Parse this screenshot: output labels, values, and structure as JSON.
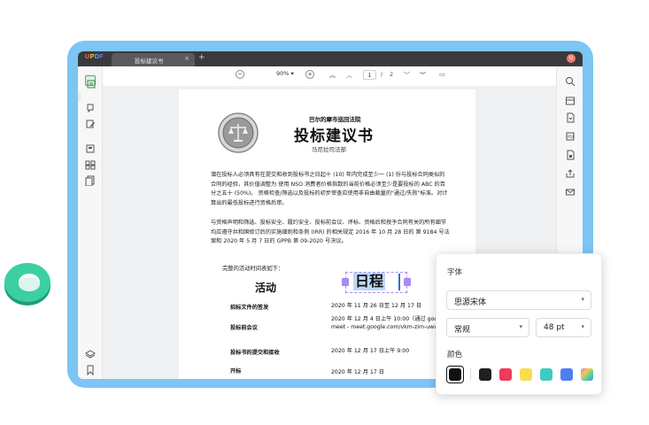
{
  "app": {
    "logo": {
      "u": "U",
      "p": "P",
      "d": "D",
      "f": "F"
    },
    "tab_title": "投标建议书",
    "tab_close": "×",
    "tab_add": "+",
    "user_initial": "U"
  },
  "topnav": {
    "zoom_out": "−",
    "zoom_value": "90%",
    "zoom_caret": "▾",
    "zoom_in": "+",
    "first_page": "︽",
    "prev_page": "︿",
    "current_page": "1",
    "page_separator": "/",
    "total_pages": "2",
    "next_page": "﹀",
    "last_page": "︾",
    "comment": "▭"
  },
  "document": {
    "court_name": "巴尔的摩市巡回法院",
    "title": "投标建议书",
    "department": "马尼拉司法部",
    "paragraph1": "潜在投标人必须具有在提交和收到投标书之日起十 (10) 年内完成至少一 (1) 份与投标合同类似的合同的经验，其价值调整为 使用 NSO 消费者价格指数的当前价格必须至少是要投标的 ABC 的百分之五十 (50%)。 资格检查/筛选以及投标的初步审查应使用非自由裁量的\"通过/失败\"标准。对计算出的最低投标进行资格后审。",
    "paragraph2": "与资格声明和筛选、投标安全、履约安全、投标前会议、评标、资格后和授予合同有关的所有细节均应遵守共和国修订后的实施细则和条例 (IRR) 的相关规定 2016 年 10 月 28 日的 第 9184 号法案和 2020 年 5 月 7 日的 GPPB 第 09-2020 号决议。",
    "intro": "完整的活动时间表如下：",
    "col_activity": "活动",
    "col_schedule": "日程",
    "rows": [
      {
        "label": "招标文件的签发",
        "value": "2020 年 11 月 26 日至 12 月 17 日"
      },
      {
        "label": "投标前会议",
        "value": "2020 年 12 月 4 日上午 10:00（通过 google meet - meet.google.com/vkm-zim-uwx）"
      },
      {
        "label": "投标书的提交和接收",
        "value": "2020 年 12 月 17 日上午 9:00"
      },
      {
        "label": "开标",
        "value": "2020 年 12 月 17 日"
      }
    ]
  },
  "panel": {
    "font_label": "字体",
    "font_family": "思源宋体",
    "font_style": "常规",
    "font_size": "48 pt",
    "color_label": "颜色",
    "dropdown_arrow": "▾",
    "swatches": [
      "#ffffff",
      "#1f1f1f",
      "#ee3a5c",
      "#f9de4b",
      "#3dccc0",
      "#4e7ff0",
      "#e8a0e8"
    ]
  },
  "colors": {
    "frame": "#7cc5f5",
    "titlebar": "#3a3a3c",
    "selection": "#a88bf0",
    "text_highlight": "#bcd8f6",
    "ring": "#2fc59b"
  }
}
